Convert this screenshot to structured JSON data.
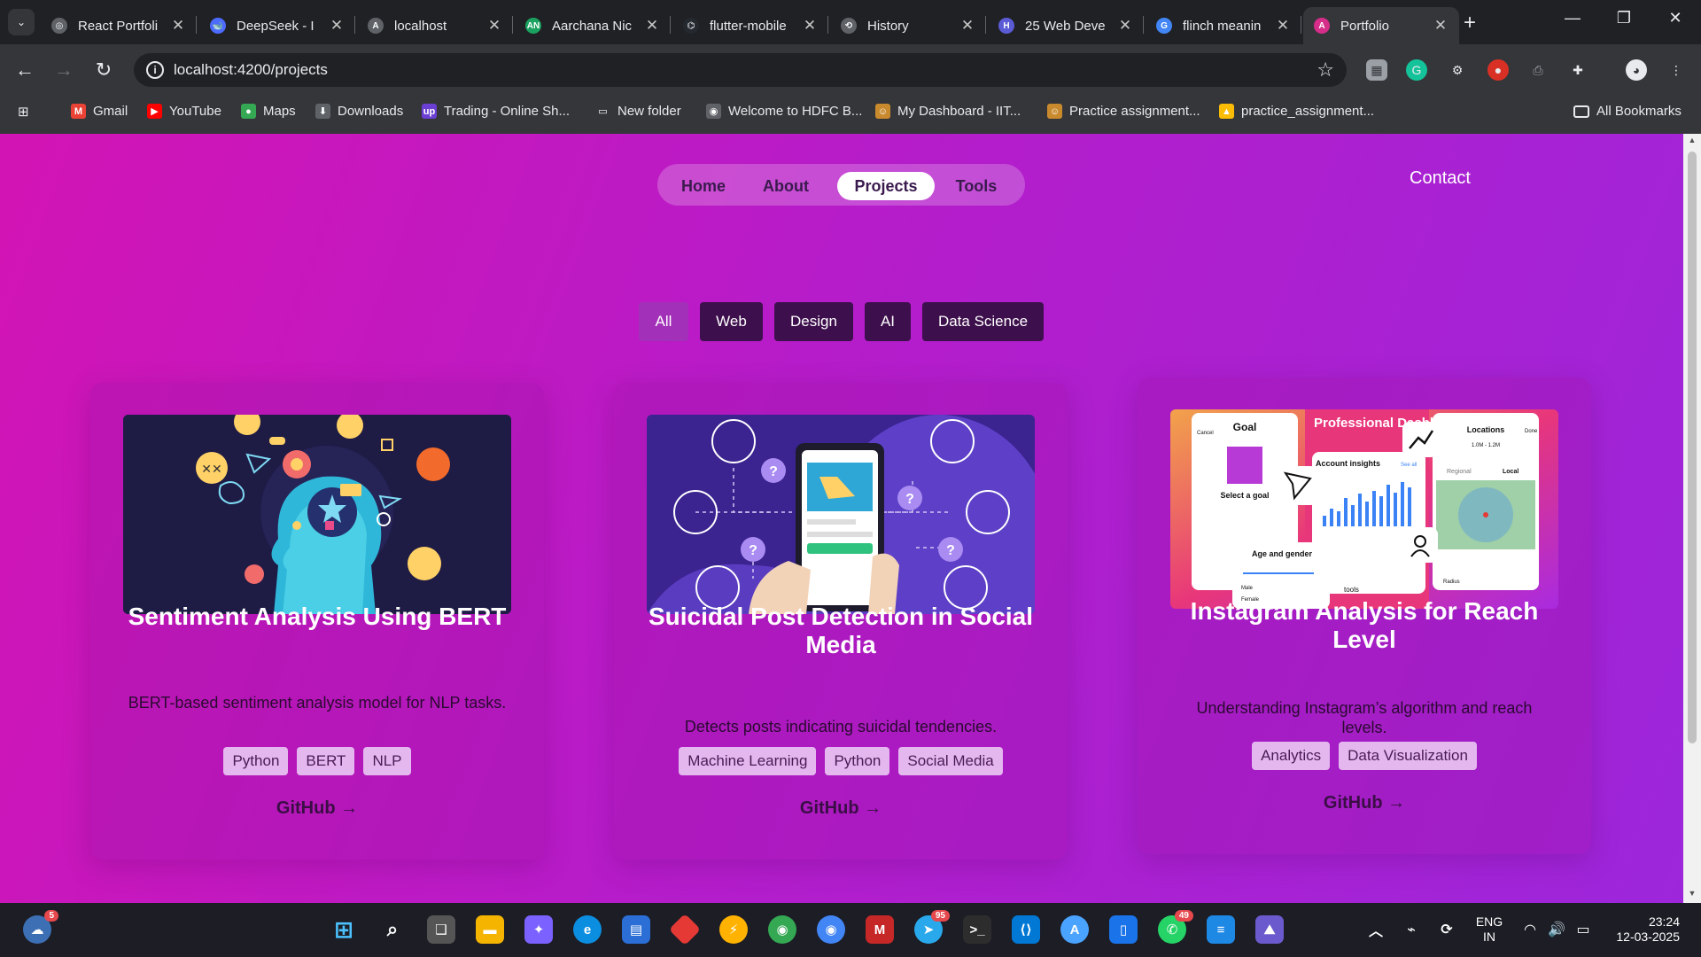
{
  "browser": {
    "tabs": [
      {
        "title": "React Portfoli",
        "fav_color": "#5f6368",
        "fav_glyph": "◎",
        "active": false
      },
      {
        "title": "DeepSeek - I",
        "fav_color": "#4d6bfe",
        "fav_glyph": "🐋",
        "active": false
      },
      {
        "title": "localhost",
        "fav_color": "#5f6368",
        "fav_glyph": "A",
        "active": false
      },
      {
        "title": "Aarchana Nic",
        "fav_color": "#1aa260",
        "fav_glyph": "AN",
        "active": false
      },
      {
        "title": "flutter-mobile",
        "fav_color": "#24292f",
        "fav_glyph": "⌬",
        "active": false
      },
      {
        "title": "History",
        "fav_color": "#5f6368",
        "fav_glyph": "⟲",
        "active": false
      },
      {
        "title": "25 Web Deve",
        "fav_color": "#5b5bd6",
        "fav_glyph": "H",
        "active": false
      },
      {
        "title": "flinch meanin",
        "fav_color": "#4285f4",
        "fav_glyph": "G",
        "active": false
      },
      {
        "title": "Portfolio",
        "fav_color": "#d62d8a",
        "fav_glyph": "A",
        "active": true
      }
    ],
    "new_tab_glyph": "+",
    "url": "localhost:4200/projects",
    "bookmarks": [
      {
        "label": "Gmail",
        "color": "#ea4335",
        "glyph": "M"
      },
      {
        "label": "YouTube",
        "color": "#ff0000",
        "glyph": "▶"
      },
      {
        "label": "Maps",
        "color": "#34a853",
        "glyph": "●"
      },
      {
        "label": "Downloads",
        "color": "#5f6368",
        "glyph": "⬇"
      },
      {
        "label": "Trading - Online Sh...",
        "color": "#6b3fd4",
        "glyph": "up"
      },
      {
        "label": "New folder",
        "color": "#35363a",
        "glyph": "▭"
      },
      {
        "label": "Welcome to HDFC B...",
        "color": "#5f6368",
        "glyph": "◉"
      },
      {
        "label": "My Dashboard - IIT...",
        "color": "#c98a2d",
        "glyph": "☺"
      },
      {
        "label": "Practice assignment...",
        "color": "#c98a2d",
        "glyph": "☺"
      },
      {
        "label": "practice_assignment...",
        "color": "#fbbc04",
        "glyph": "▲"
      }
    ],
    "all_bookmarks": "All Bookmarks"
  },
  "site": {
    "nav": [
      {
        "label": "Home",
        "active": false
      },
      {
        "label": "About",
        "active": false
      },
      {
        "label": "Projects",
        "active": true
      },
      {
        "label": "Tools",
        "active": false
      }
    ],
    "contact": "Contact",
    "filters": [
      {
        "label": "All",
        "active": true
      },
      {
        "label": "Web",
        "active": false
      },
      {
        "label": "Design",
        "active": false
      },
      {
        "label": "AI",
        "active": false
      },
      {
        "label": "Data Science",
        "active": false
      }
    ],
    "projects": [
      {
        "title": "Sentiment Analysis Using BERT",
        "description": "BERT-based sentiment analysis model for NLP tasks.",
        "tags": [
          "Python",
          "BERT",
          "NLP"
        ],
        "link": "GitHub",
        "image": "head-with-emojis-illustration"
      },
      {
        "title": "Suicidal Post Detection in Social Media",
        "description": "Detects posts indicating suicidal tendencies.",
        "tags": [
          "Machine Learning",
          "Python",
          "Social Media"
        ],
        "link": "GitHub",
        "image": "phone-social-icons-illustration"
      },
      {
        "title": "Instagram Analysis for Reach Level",
        "description": "Understanding Instagram’s algorithm and reach levels.",
        "tags": [
          "Analytics",
          "Data Visualization"
        ],
        "link": "GitHub",
        "image": "professional-dashboard-collage",
        "image_texts": {
          "goal": "Goal",
          "cancel": "Cancel",
          "select_goal": "Select a goal",
          "dashboard": "Professional Dashboard",
          "insights": "Account insights",
          "see_all": "See all",
          "locations": "Locations",
          "done": "Done",
          "regional": "Regional",
          "local": "Local",
          "age_gender": "Age and gender",
          "male": "Male",
          "female": "Female",
          "radius": "Radius",
          "tools": "tools",
          "range": "1.0M - 1.2M"
        }
      }
    ]
  },
  "taskbar": {
    "weather_badge": "5",
    "telegram_badge": "95",
    "whatsapp_badge": "49",
    "language": "ENG",
    "region": "IN",
    "time": "23:24",
    "date": "12-03-2025"
  }
}
